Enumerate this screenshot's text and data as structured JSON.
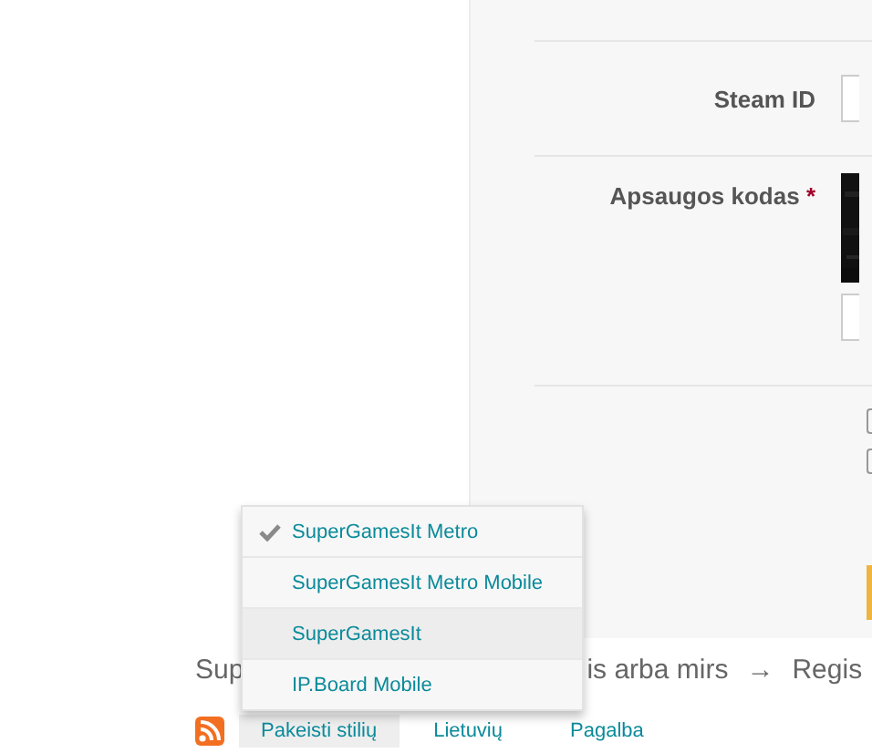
{
  "form": {
    "fields": [
      {
        "kind": "text",
        "label": "Steam ID"
      },
      {
        "kind": "captcha",
        "label": "Apsaugos kodas",
        "required_mark": "*"
      }
    ],
    "options": [
      {
        "checked": false
      },
      {
        "checked": false
      }
    ]
  },
  "breadcrumb": {
    "start": "Sup",
    "rest": "is arba mirs",
    "arrow": "→",
    "next": "Regis"
  },
  "style_menu": {
    "items": [
      {
        "label": "SuperGamesIt Metro",
        "selected": true,
        "hovered": false
      },
      {
        "label": "SuperGamesIt Metro Mobile",
        "selected": false,
        "hovered": false
      },
      {
        "label": "SuperGamesIt",
        "selected": false,
        "hovered": true
      },
      {
        "label": "IP.Board Mobile",
        "selected": false,
        "hovered": false
      }
    ]
  },
  "footer": {
    "style_button": "Pakeisti stilių",
    "links": [
      "Lietuvių",
      "Pagalba"
    ]
  }
}
